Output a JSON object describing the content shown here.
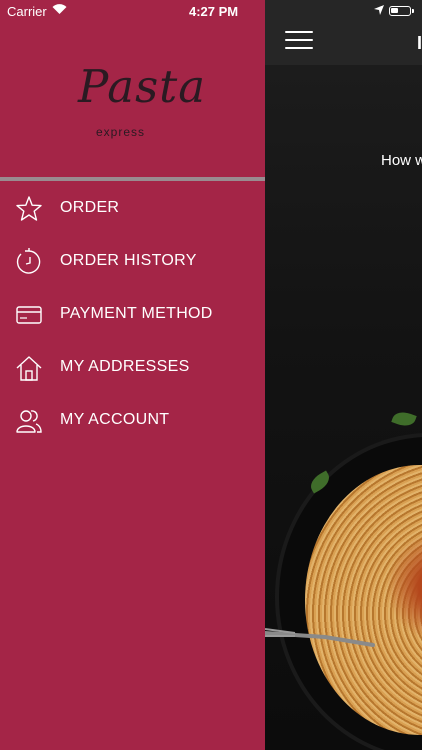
{
  "status_bar": {
    "carrier": "Carrier",
    "time": "4:27 PM"
  },
  "drawer": {
    "logo": {
      "name": "Pasta",
      "sub": "express"
    },
    "background_color": "#a42547",
    "menu": [
      {
        "label": "ORDER",
        "icon": "star-icon"
      },
      {
        "label": "ORDER HISTORY",
        "icon": "clock-history-icon"
      },
      {
        "label": "PAYMENT METHOD",
        "icon": "credit-card-icon"
      },
      {
        "label": "MY ADDRESSES",
        "icon": "home-icon"
      },
      {
        "label": "MY ACCOUNT",
        "icon": "users-icon"
      }
    ]
  },
  "main": {
    "tagline_partial": "How w"
  }
}
